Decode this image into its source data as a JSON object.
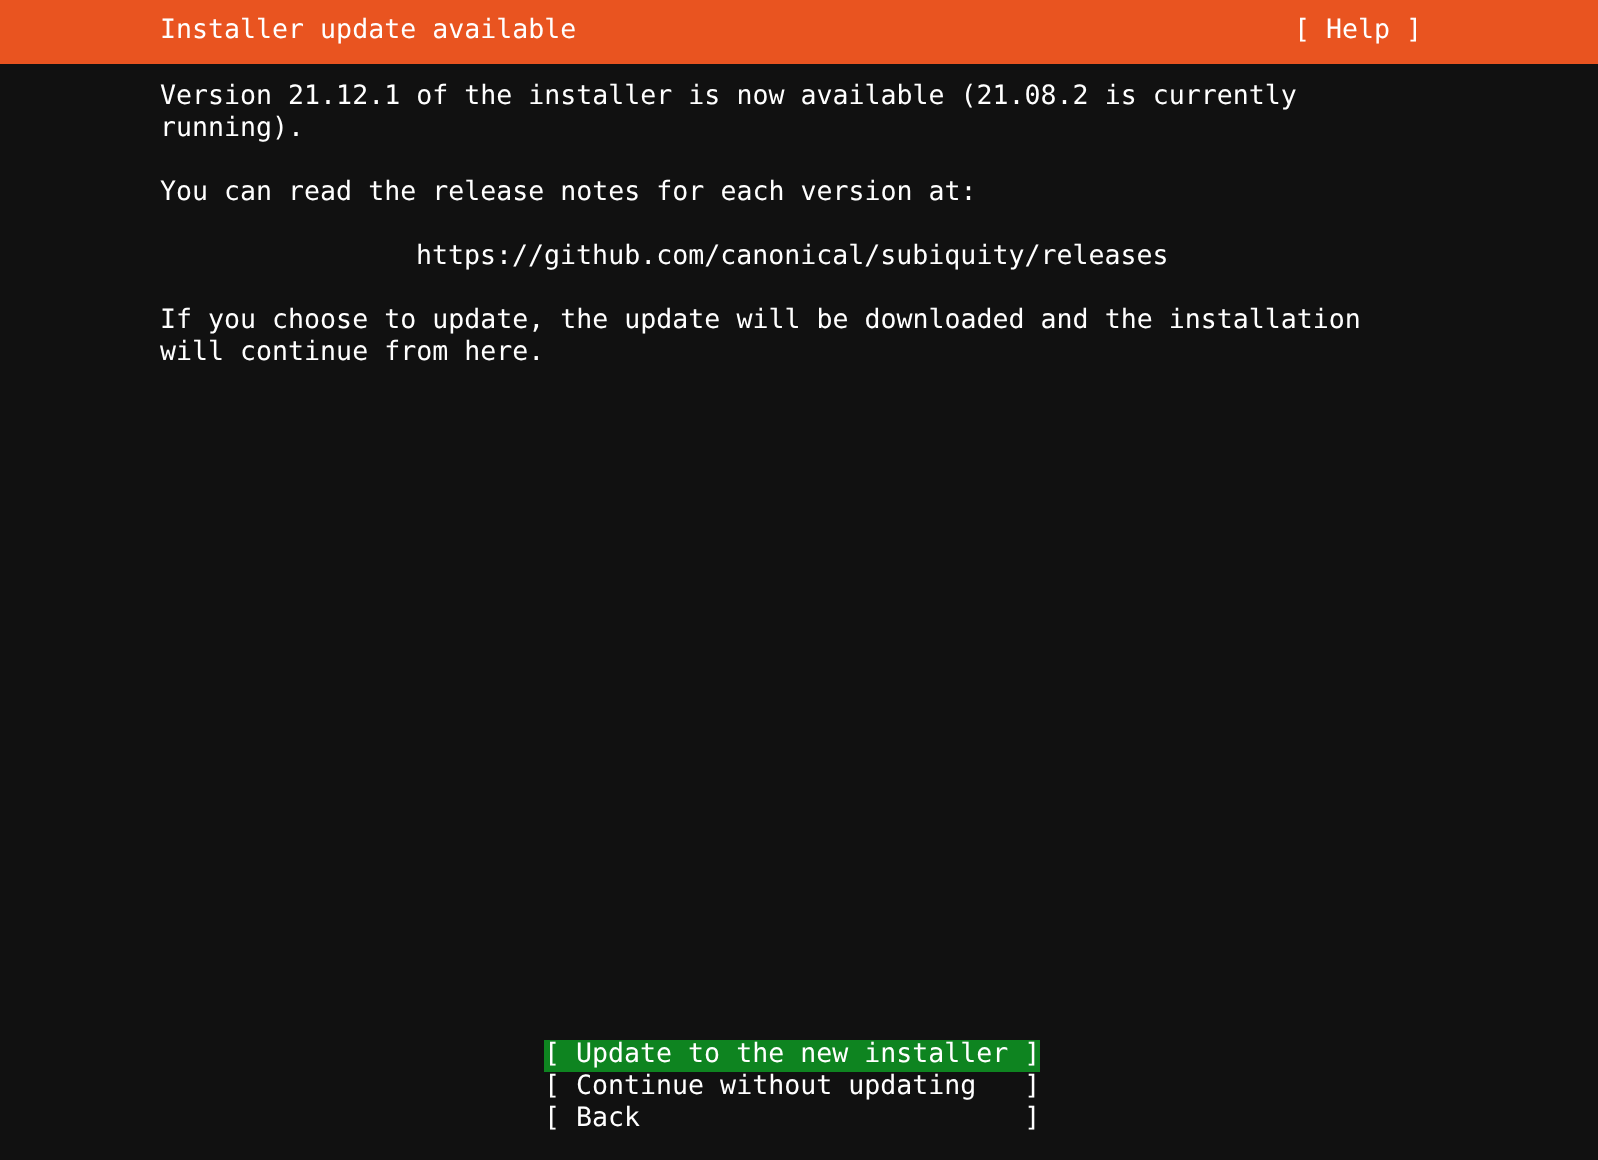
{
  "header": {
    "title": "Installer update available",
    "help": "[ Help ]"
  },
  "paragraphs": [
    {
      "kind": "text",
      "text": "Version 21.12.1 of the installer is now available (21.08.2 is currently running)."
    },
    {
      "kind": "text",
      "text": "You can read the release notes for each version at:"
    },
    {
      "kind": "url",
      "text": "https://github.com/canonical/subiquity/releases"
    },
    {
      "kind": "text",
      "text": "If you choose to update, the update will be downloaded and the installation will continue from here."
    }
  ],
  "buttons": [
    {
      "label": "[ Update to the new installer ]",
      "selected": true
    },
    {
      "label": "[ Continue without updating   ]",
      "selected": false
    },
    {
      "label": "[ Back                        ]",
      "selected": false
    }
  ]
}
